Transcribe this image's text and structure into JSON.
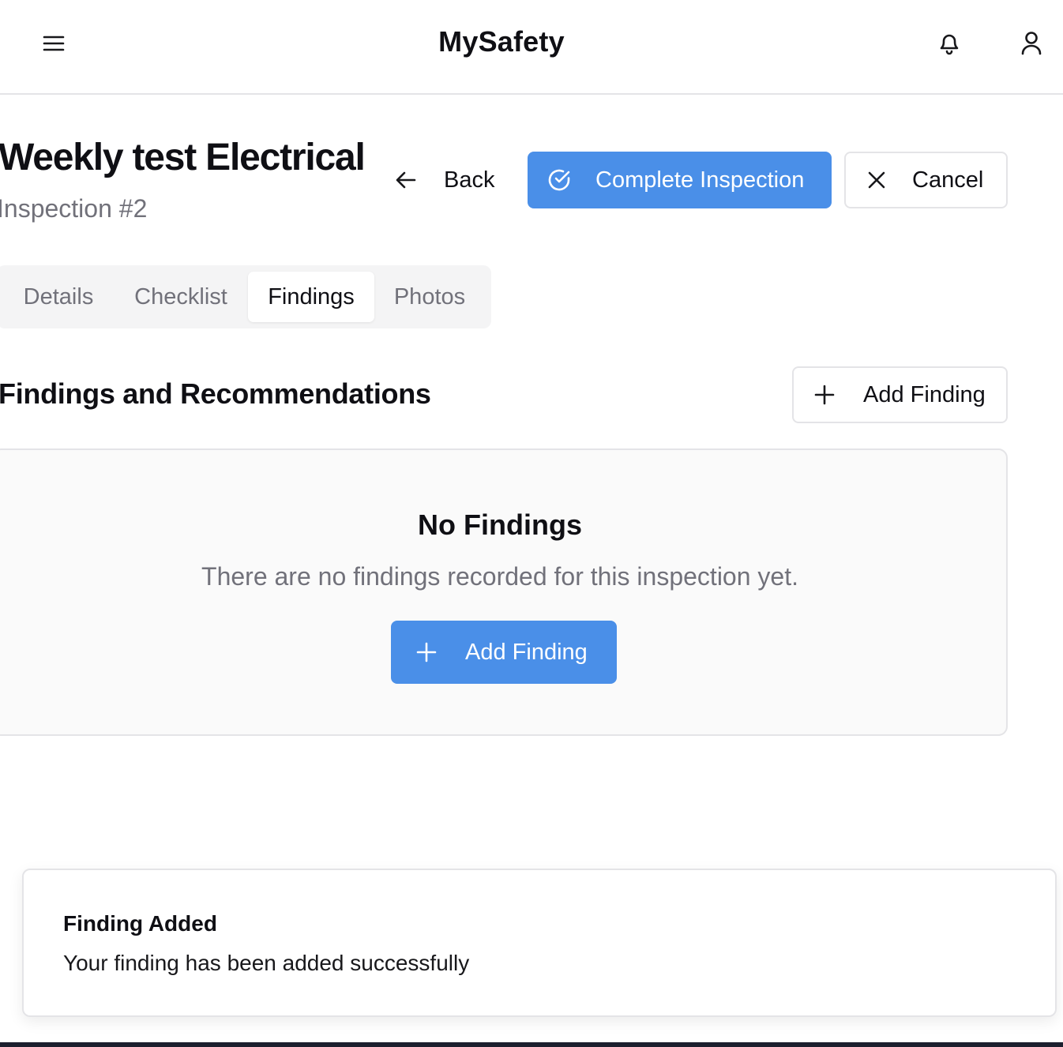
{
  "header": {
    "app_title": "MySafety",
    "menu_icon": "menu-icon",
    "notifications_icon": "bell-icon",
    "user_icon": "user-icon"
  },
  "inspection": {
    "title": "Weekly test Electrical",
    "subtitle": "Inspection #2"
  },
  "actions": {
    "back_label": "Back",
    "complete_label": "Complete Inspection",
    "cancel_label": "Cancel"
  },
  "tabs": [
    {
      "label": "Details",
      "active": false
    },
    {
      "label": "Checklist",
      "active": false
    },
    {
      "label": "Findings",
      "active": true
    },
    {
      "label": "Photos",
      "active": false
    }
  ],
  "findings": {
    "section_title": "Findings and Recommendations",
    "add_label": "Add Finding",
    "empty_title": "No Findings",
    "empty_text": "There are no findings recorded for this inspection yet.",
    "empty_add_label": "Add Finding"
  },
  "toast": {
    "title": "Finding Added",
    "description": "Your finding has been added successfully"
  },
  "colors": {
    "primary": "#4a8fe8",
    "border": "#e4e4e7",
    "muted_text": "#71717a",
    "muted_bg": "#f4f4f5"
  }
}
